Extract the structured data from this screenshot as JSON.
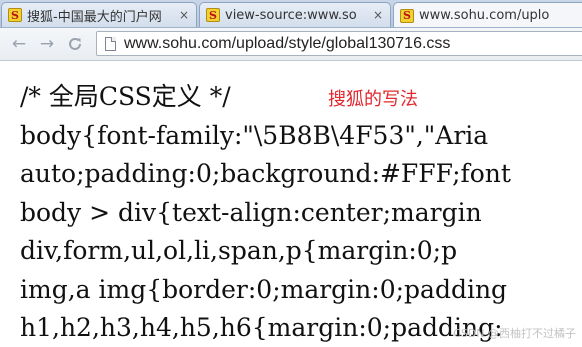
{
  "browser": {
    "tabs": [
      {
        "title": "搜狐-中国最大的门户网",
        "close": "×",
        "favicon": "S"
      },
      {
        "title": "view-source:www.so",
        "close": "×",
        "favicon": "S"
      },
      {
        "title": "www.sohu.com/uplo",
        "close": "×",
        "favicon": "S"
      }
    ],
    "active_tab": 2,
    "nav": {
      "back_icon": "←",
      "forward_icon": "→"
    },
    "address": {
      "url": "www.sohu.com/upload/style/global130716.css"
    }
  },
  "document": {
    "lines": [
      "/* 全局CSS定义 */",
      "body{font-family:\"\\5B8B\\4F53\",\"Aria",
      "auto;padding:0;background:#FFF;font",
      "body > div{text-align:center;margin",
      "div,form,ul,ol,li,span,p{margin:0;p",
      "img,a img{border:0;margin:0;padding",
      "h1,h2,h3,h4,h5,h6{margin:0;padding:"
    ],
    "annotation": "搜狐的写法",
    "watermark": "CSDN @西柚打不过橘子",
    "annotation_color": "#e0282e"
  }
}
